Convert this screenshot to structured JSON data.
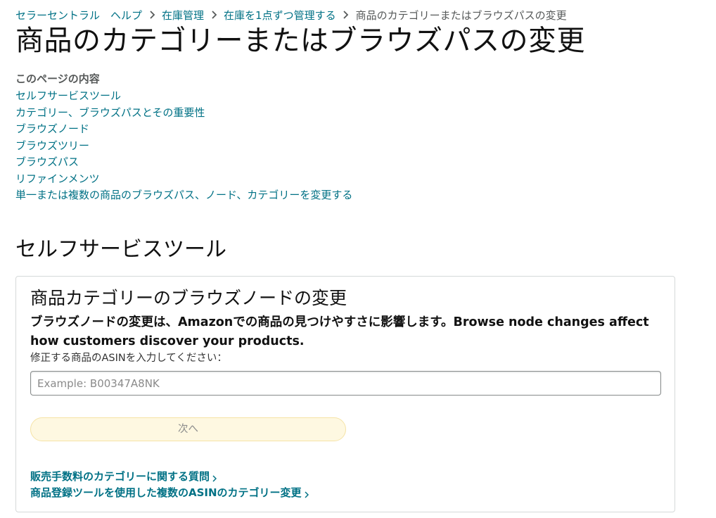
{
  "breadcrumb": [
    {
      "label": "セラーセントラル　ヘルプ"
    },
    {
      "label": "在庫管理"
    },
    {
      "label": "在庫を1点ずつ管理する"
    },
    {
      "label": "商品のカテゴリーまたはブラウズパスの変更"
    }
  ],
  "page_title": "商品のカテゴリーまたはブラウズパスの変更",
  "toc": {
    "heading": "このページの内容",
    "items": [
      "セルフサービスツール",
      "カテゴリー、ブラウズパスとその重要性",
      "ブラウズノード",
      "ブラウズツリー",
      "ブラウズパス",
      "リファインメンツ",
      "単一または複数の商品のブラウズパス、ノード、カテゴリーを変更する"
    ]
  },
  "section_heading": "セルフサービスツール",
  "tool": {
    "title": "商品カテゴリーのブラウズノードの変更",
    "description": "ブラウズノードの変更は、Amazonでの商品の見つけやすさに影響します。Browse node changes affect how customers discover your products.",
    "field_label": "修正する商品のASINを入力してください：",
    "input_value": "",
    "input_placeholder": "Example: B00347A8NK",
    "next_label": "次へ",
    "links": [
      "販売手数料のカテゴリーに関する質問",
      "商品登録ツールを使用した複数のASINのカテゴリー変更"
    ]
  },
  "colors": {
    "link": "#007185",
    "text": "#111111",
    "muted": "#565959",
    "button_bg": "#fef8e1",
    "button_border": "#f5e3a6"
  },
  "icons": {
    "breadcrumb_separator": "chevron-right-icon",
    "link_arrow": "chevron-right-icon"
  }
}
